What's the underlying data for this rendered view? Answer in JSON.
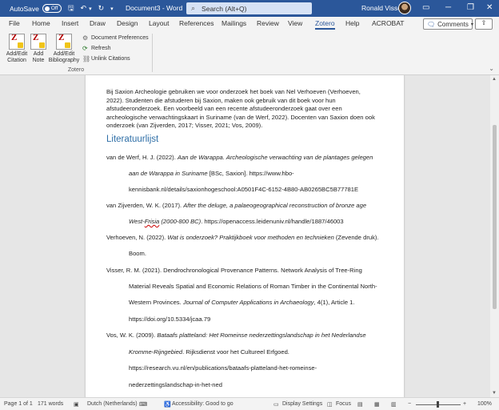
{
  "titlebar": {
    "autosave_label": "AutoSave",
    "autosave_state": "Off",
    "doc_title": "Document3 - Word",
    "search_placeholder": "Search (Alt+Q)",
    "user_name": "Ronald Visser"
  },
  "tabs": [
    "File",
    "Home",
    "Insert",
    "Draw",
    "Design",
    "Layout",
    "References",
    "Mailings",
    "Review",
    "View",
    "Zotero",
    "Help",
    "ACROBAT"
  ],
  "active_tab": "Zotero",
  "comments_label": "Comments",
  "ribbon": {
    "add_edit_citation": [
      "Add/Edit",
      "Citation"
    ],
    "add_note": [
      "Add",
      "Note"
    ],
    "add_edit_bibliography": [
      "Add/Edit",
      "Bibliography"
    ],
    "document_preferences": "Document Preferences",
    "refresh": "Refresh",
    "unlink_citations": "Unlink Citations",
    "group_label": "Zotero"
  },
  "document": {
    "paragraph": [
      "Bij Saxion Archeologie gebruiken we voor onderzoek het boek van Nel Verhoeven (Verhoeven,",
      "2022). Studenten die afstuderen bij Saxion, maken ook gebruik van dit boek voor hun",
      "afstudeeronderzoek. Een voorbeeld van een recente afstudeeronderzoek gaat over een",
      "archeologische verwachtingskaart in Suriname (van de Werf, 2022). Docenten van Saxion doen ook",
      "onderzoek (van Zijverden, 2017; Visser, 2021; Vos, 2009)."
    ],
    "heading": "Literatuurlijst",
    "refs": [
      {
        "a": "van de Werf, H. J. (2022). ",
        "i": "Aan de Warappa. Archeologische verwachting van de plantages gelegen",
        "b": ""
      },
      {
        "a": "",
        "i": "aan de Warappa in Suriname",
        "b": " [BSc, Saxion]. https://www.hbo-"
      },
      {
        "a": "kennisbank.nl/details/saxionhogeschool:A0501F4C-6152-4B80-AB0265BC5B77781E",
        "i": "",
        "b": ""
      },
      {
        "a": "van Zijverden, W. K. (2017). ",
        "i": "After the deluge, a palaeogeographical reconstruction of bronze age",
        "b": ""
      },
      {
        "a": "",
        "i": "West-",
        "s": "Frisia",
        "i2": " (2000-800 BC)",
        "b": ". https://openaccess.leidenuniv.nl/handle/1887/46003"
      },
      {
        "a": "Verhoeven, N. (2022). ",
        "i": "Wat is onderzoek? Praktijkboek voor methoden en technieken",
        "b": " (Zevende druk)."
      },
      {
        "a": "Boom.",
        "i": "",
        "b": ""
      },
      {
        "a": "Visser, R. M. (2021). Dendrochronological Provenance Patterns. Network Analysis of Tree-Ring",
        "i": "",
        "b": ""
      },
      {
        "a": "Material Reveals Spatial and Economic Relations of Roman Timber in the Continental North-",
        "i": "",
        "b": ""
      },
      {
        "a": "Western Provinces. ",
        "i": "Journal of Computer Applications in Archaeology",
        "b": ", 4(1), Article 1."
      },
      {
        "a": "https://doi.org/10.5334/jcaa.79",
        "i": "",
        "b": ""
      },
      {
        "a": "Vos, W. K. (2009). ",
        "i": "Bataafs platteland: Het Romeinse nederzettingslandschap in het Nederlandse",
        "b": ""
      },
      {
        "a": "",
        "i": "Kromme-Rijngebied",
        "b": ". Rijksdienst voor het Cultureel Erfgoed."
      },
      {
        "a": "https://research.vu.nl/en/publications/bataafs-platteland-het-romeinse-",
        "i": "",
        "b": ""
      },
      {
        "a": "nederzettingslandschap-in-het-ned",
        "i": "",
        "b": ""
      }
    ]
  },
  "status": {
    "page": "Page 1 of 1",
    "words": "171 words",
    "language": "Dutch (Netherlands)",
    "accessibility": "Accessibility: Good to go",
    "display_settings": "Display Settings",
    "focus": "Focus",
    "zoom": "100%"
  }
}
